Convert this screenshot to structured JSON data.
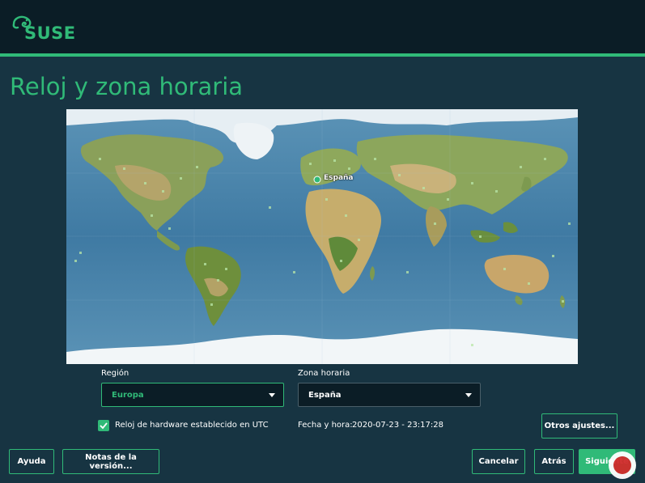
{
  "header": {
    "logo_text": "SUSE"
  },
  "page": {
    "title": "Reloj y zona horaria"
  },
  "map": {
    "selected_city": "España"
  },
  "region": {
    "label": "Región",
    "value": "Europa"
  },
  "timezone": {
    "label": "Zona horaria",
    "value": "España"
  },
  "utc_checkbox": {
    "label": "Reloj de hardware establecido en UTC",
    "checked": true
  },
  "datetime": {
    "label": "Fecha y hora:",
    "value": "2020-07-23 - 23:17:28"
  },
  "buttons": {
    "other_settings": "Otros ajustes...",
    "help": "Ayuda",
    "release_notes": "Notas de la versión...",
    "cancel": "Cancelar",
    "back": "Atrás",
    "next": "Siguiente"
  },
  "colors": {
    "accent": "#30ba78",
    "background": "#173442",
    "header": "#0b1d26"
  }
}
